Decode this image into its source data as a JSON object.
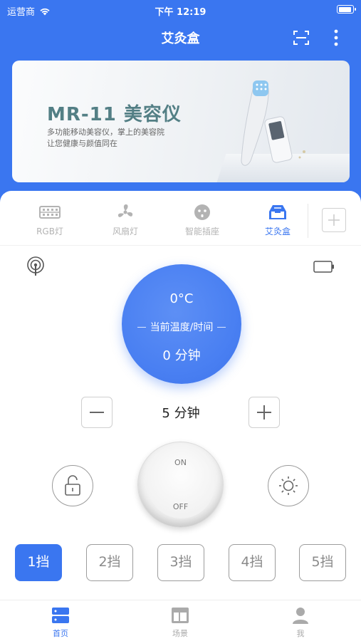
{
  "status_bar": {
    "carrier": "运营商",
    "time": "下午 12:19"
  },
  "nav": {
    "title": "艾灸盒"
  },
  "banner": {
    "title": "MR-11 美容仪",
    "subtitle_1": "多功能移动美容仪，掌上的美容院",
    "subtitle_2": "让您健康与颜值同在"
  },
  "device_tabs": [
    {
      "label": "RGB灯",
      "icon": "led-strip-icon",
      "active": false
    },
    {
      "label": "风扇灯",
      "icon": "fan-icon",
      "active": false
    },
    {
      "label": "智能插座",
      "icon": "socket-icon",
      "active": false
    },
    {
      "label": "艾灸盒",
      "icon": "moxibustion-box-icon",
      "active": true
    }
  ],
  "control": {
    "temperature": "0°C",
    "center_label": "当前温度/时间",
    "elapsed": "0 分钟",
    "timer_value": "5 分钟",
    "power_on": "ON",
    "power_off": "OFF"
  },
  "gears": [
    "1挡",
    "2挡",
    "3挡",
    "4挡",
    "5挡"
  ],
  "gear_selected": "1挡",
  "bottom_tabs": [
    {
      "label": "首页",
      "icon": "home-icon",
      "active": true
    },
    {
      "label": "场景",
      "icon": "scene-icon",
      "active": false
    },
    {
      "label": "我",
      "icon": "profile-icon",
      "active": false
    }
  ],
  "colors": {
    "primary": "#3a76f0",
    "inactive": "#b3b3b3"
  }
}
